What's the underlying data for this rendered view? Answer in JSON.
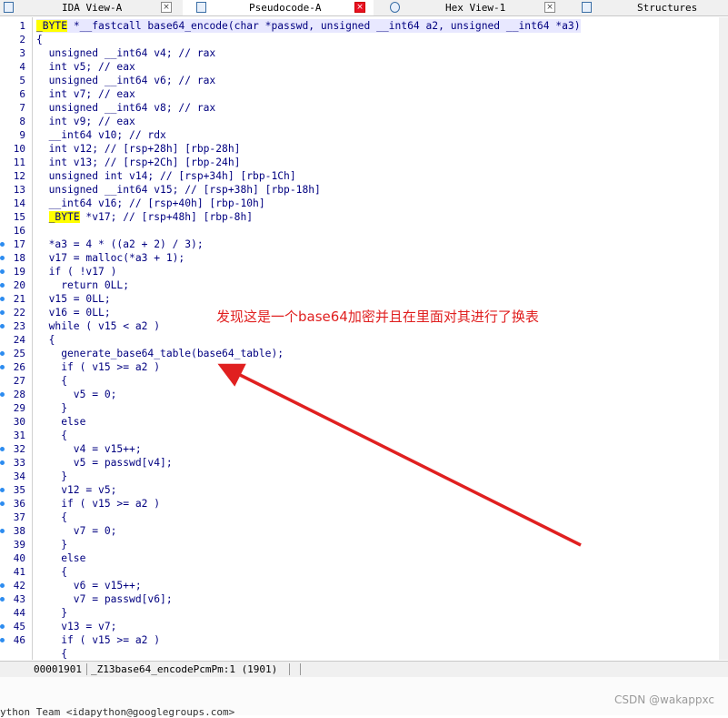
{
  "tabs": [
    {
      "label": "IDA View-A",
      "active": false
    },
    {
      "label": "Pseudocode-A",
      "active": true
    },
    {
      "label": "Hex View-1",
      "active": false
    },
    {
      "label": "Structures",
      "active": false
    }
  ],
  "code": [
    {
      "n": "1",
      "bp": false,
      "text": "_BYTE *__fastcall base64_encode(char *passwd, unsigned __int64 a2, unsigned __int64 *a3)"
    },
    {
      "n": "2",
      "bp": false,
      "text": "{"
    },
    {
      "n": "3",
      "bp": false,
      "text": "  unsigned __int64 v4; // rax"
    },
    {
      "n": "4",
      "bp": false,
      "text": "  int v5; // eax"
    },
    {
      "n": "5",
      "bp": false,
      "text": "  unsigned __int64 v6; // rax"
    },
    {
      "n": "6",
      "bp": false,
      "text": "  int v7; // eax"
    },
    {
      "n": "7",
      "bp": false,
      "text": "  unsigned __int64 v8; // rax"
    },
    {
      "n": "8",
      "bp": false,
      "text": "  int v9; // eax"
    },
    {
      "n": "9",
      "bp": false,
      "text": "  __int64 v10; // rdx"
    },
    {
      "n": "10",
      "bp": false,
      "text": "  int v12; // [rsp+28h] [rbp-28h]"
    },
    {
      "n": "11",
      "bp": false,
      "text": "  int v13; // [rsp+2Ch] [rbp-24h]"
    },
    {
      "n": "12",
      "bp": false,
      "text": "  unsigned int v14; // [rsp+34h] [rbp-1Ch]"
    },
    {
      "n": "13",
      "bp": false,
      "text": "  unsigned __int64 v15; // [rsp+38h] [rbp-18h]"
    },
    {
      "n": "14",
      "bp": false,
      "text": "  __int64 v16; // [rsp+40h] [rbp-10h]"
    },
    {
      "n": "15",
      "bp": false,
      "text": "  _BYTE *v17; // [rsp+48h] [rbp-8h]"
    },
    {
      "n": "16",
      "bp": false,
      "text": ""
    },
    {
      "n": "17",
      "bp": true,
      "text": "  *a3 = 4 * ((a2 + 2) / 3);"
    },
    {
      "n": "18",
      "bp": true,
      "text": "  v17 = malloc(*a3 + 1);"
    },
    {
      "n": "19",
      "bp": true,
      "text": "  if ( !v17 )"
    },
    {
      "n": "20",
      "bp": true,
      "text": "    return 0LL;"
    },
    {
      "n": "21",
      "bp": true,
      "text": "  v15 = 0LL;"
    },
    {
      "n": "22",
      "bp": true,
      "text": "  v16 = 0LL;"
    },
    {
      "n": "23",
      "bp": true,
      "text": "  while ( v15 < a2 )"
    },
    {
      "n": "24",
      "bp": false,
      "text": "  {"
    },
    {
      "n": "25",
      "bp": true,
      "text": "    generate_base64_table(base64_table);"
    },
    {
      "n": "26",
      "bp": true,
      "text": "    if ( v15 >= a2 )"
    },
    {
      "n": "27",
      "bp": false,
      "text": "    {"
    },
    {
      "n": "28",
      "bp": true,
      "text": "      v5 = 0;"
    },
    {
      "n": "29",
      "bp": false,
      "text": "    }"
    },
    {
      "n": "30",
      "bp": false,
      "text": "    else"
    },
    {
      "n": "31",
      "bp": false,
      "text": "    {"
    },
    {
      "n": "32",
      "bp": true,
      "text": "      v4 = v15++;"
    },
    {
      "n": "33",
      "bp": true,
      "text": "      v5 = passwd[v4];"
    },
    {
      "n": "34",
      "bp": false,
      "text": "    }"
    },
    {
      "n": "35",
      "bp": true,
      "text": "    v12 = v5;"
    },
    {
      "n": "36",
      "bp": true,
      "text": "    if ( v15 >= a2 )"
    },
    {
      "n": "37",
      "bp": false,
      "text": "    {"
    },
    {
      "n": "38",
      "bp": true,
      "text": "      v7 = 0;"
    },
    {
      "n": "39",
      "bp": false,
      "text": "    }"
    },
    {
      "n": "40",
      "bp": false,
      "text": "    else"
    },
    {
      "n": "41",
      "bp": false,
      "text": "    {"
    },
    {
      "n": "42",
      "bp": true,
      "text": "      v6 = v15++;"
    },
    {
      "n": "43",
      "bp": true,
      "text": "      v7 = passwd[v6];"
    },
    {
      "n": "44",
      "bp": false,
      "text": "    }"
    },
    {
      "n": "45",
      "bp": true,
      "text": "    v13 = v7;"
    },
    {
      "n": "46",
      "bp": true,
      "text": "    if ( v15 >= a2 )"
    },
    {
      "n": "",
      "bp": false,
      "text": "    {"
    }
  ],
  "status": {
    "address": "00001901",
    "function": "_Z13base64_encodePcmPm:1 (1901)"
  },
  "lower_pane_text": "ython Team <idapython@googlegroups.com>",
  "annotation_text": "发现这是一个base64加密并且在里面对其进行了换表",
  "watermark": "CSDN @wakappxc",
  "colors": {
    "code_text": "#000080",
    "highlight": "#ffff00",
    "annotation": "#e02020",
    "breakpoint_dot": "#2d8cf0"
  }
}
